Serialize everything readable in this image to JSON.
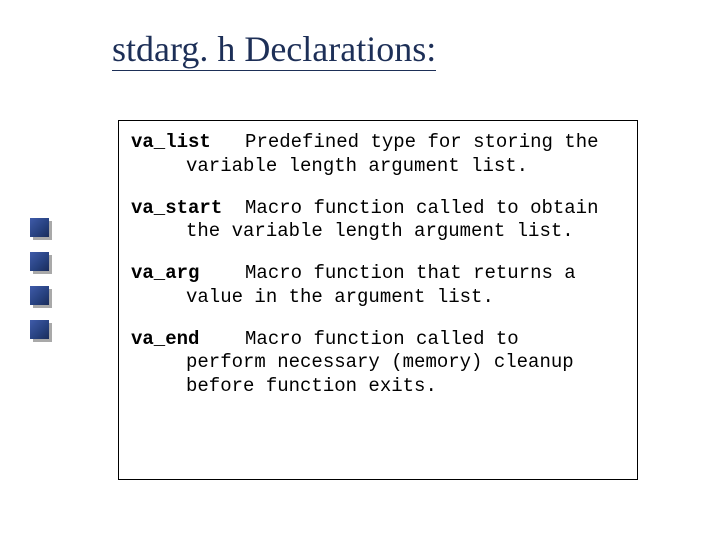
{
  "title": "stdarg. h Declarations:",
  "entries": [
    {
      "term": "va_list",
      "gap": "   ",
      "first": "Predefined type for storing the",
      "rest": "variable length argument list."
    },
    {
      "term": "va_start",
      "gap": "  ",
      "first": "Macro function called to obtain",
      "rest": "the variable length argument list."
    },
    {
      "term": "va_arg",
      "gap": "    ",
      "first": "Macro function that returns a",
      "rest": "value in the argument list."
    },
    {
      "term": "va_end",
      "gap": "    ",
      "first": "Macro function called to",
      "rest": "perform necessary (memory) cleanup before function exits."
    }
  ]
}
